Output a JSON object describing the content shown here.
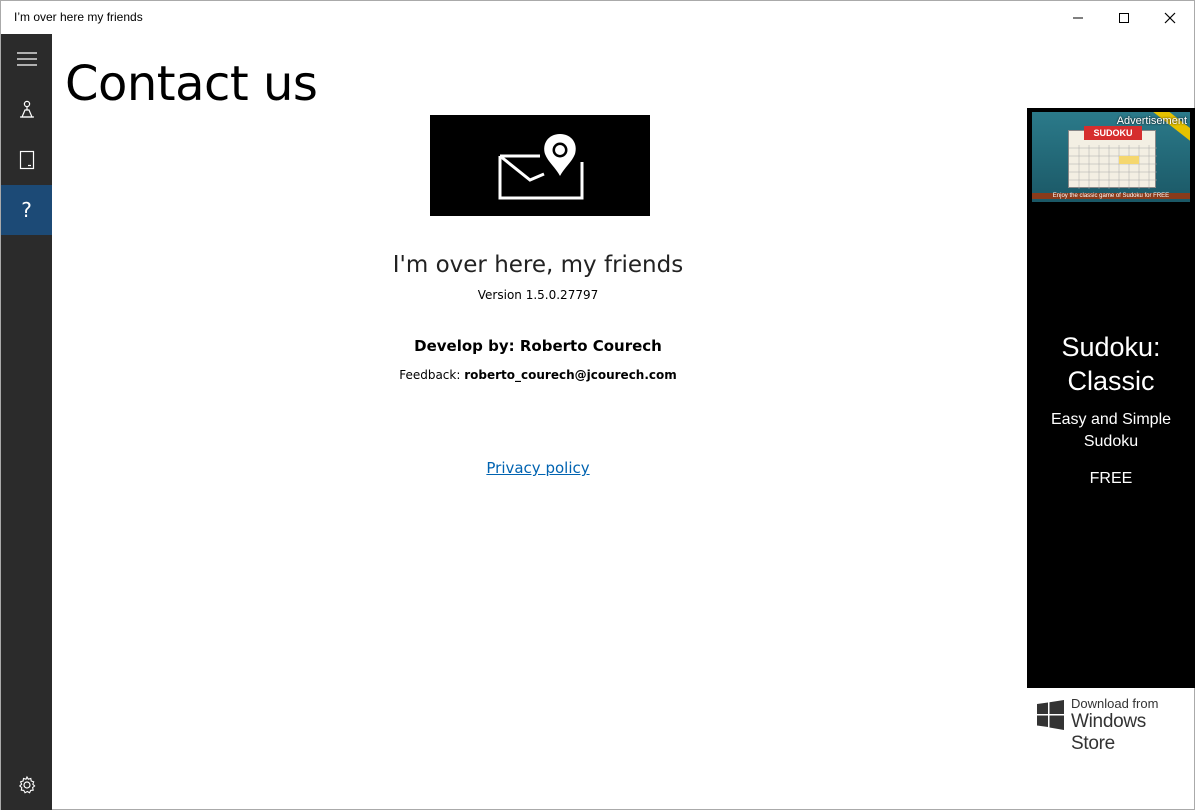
{
  "window": {
    "title": "I’m over here my friends"
  },
  "sidebar": {
    "items": [
      {
        "icon": "hamburger-icon"
      },
      {
        "icon": "location-person-icon"
      },
      {
        "icon": "tablet-icon"
      },
      {
        "icon": "help-icon",
        "label": "?",
        "active": true
      },
      {
        "icon": "settings-gear-icon"
      }
    ]
  },
  "page": {
    "title": "Contact us"
  },
  "about": {
    "app_name": "I'm over here, my friends",
    "version": "Version 1.5.0.27797",
    "developer": "Develop by: Roberto Courech",
    "feedback_label": "Feedback: ",
    "feedback_email": "roberto_courech@jcourech.com",
    "privacy_link": "Privacy policy"
  },
  "ad": {
    "label": "Advertisement",
    "banner_header": "SUDOKU",
    "banner_caption": "Enjoy the classic game of Sudoku for FREE",
    "title_line1": "Sudoku:",
    "title_line2": "Classic",
    "subtitle_line1": "Easy and Simple",
    "subtitle_line2": "Sudoku",
    "price": "FREE",
    "store_small": "Download from",
    "store_big": "Windows Store"
  },
  "colors": {
    "sidebar_bg": "#2b2b2b",
    "sidebar_active": "#1c4a76",
    "link": "#0063b1",
    "ad_bg": "#000000"
  }
}
